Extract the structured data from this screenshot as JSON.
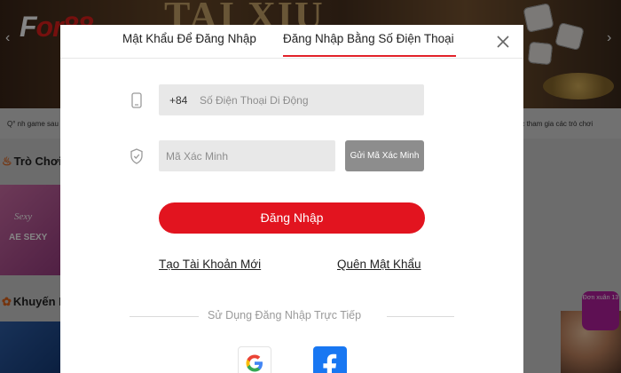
{
  "background": {
    "banner_title": "TAI XIU",
    "logo": {
      "first": "F",
      "rest": "or88"
    },
    "marquee_left": "Q° nh game sau",
    "marquee_right": "hoặc tham gia các trò chơi",
    "section_games": "Trò Chơi",
    "section_promos": "Khuyến M",
    "game_card_brand": "Sexy",
    "game_card_label": "AE SEXY",
    "promo_badge": "Đơn xuân 13"
  },
  "modal": {
    "tabs": [
      {
        "label": "Mật Khẩu Để Đăng Nhập",
        "active": false
      },
      {
        "label": "Đăng Nhập Bằng Số Điện Thoại",
        "active": true
      }
    ],
    "close_icon": "close-icon",
    "phone": {
      "icon": "phone-icon",
      "prefix": "+84",
      "placeholder": "Số Điện Thoại Di Động",
      "value": ""
    },
    "code": {
      "icon": "shield-check-icon",
      "placeholder": "Mã Xác Minh",
      "value": "",
      "send_label": "Gửi Mã Xác Minh"
    },
    "login_label": "Đăng Nhập",
    "register_link": "Tạo Tài Khoản Mới",
    "forgot_link": "Quên Mật Khẩu",
    "divider_text": "Sử Dụng Đăng Nhập Trực Tiếp",
    "social": [
      "google-icon",
      "facebook-icon"
    ]
  },
  "colors": {
    "accent": "#e2141f",
    "tab_underline": "#e2222a",
    "send_button": "#8d8d8d",
    "input_bg": "#e8e8e8",
    "facebook": "#1877f2"
  }
}
